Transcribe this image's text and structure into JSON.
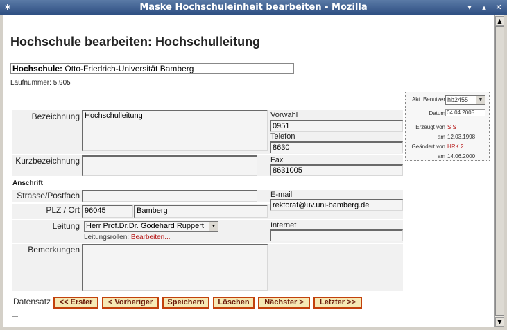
{
  "window": {
    "title": "Maske Hochschuleinheit bearbeiten - Mozilla"
  },
  "page": {
    "heading": "Hochschule bearbeiten: Hochschulleitung",
    "hochschule_label": "Hochschule:",
    "hochschule_value": "Otto-Friedrich-Universität Bamberg",
    "laufnummer": "Laufnummer: 5.905"
  },
  "form": {
    "bezeichnung_label": "Bezeichnung",
    "bezeichnung_value": "Hochschulleitung",
    "kurzbezeichnung_label": "Kurzbezeichnung",
    "kurzbezeichnung_value": "",
    "anschrift_heading": "Anschrift",
    "strasse_label": "Strasse/Postfach",
    "strasse_value": "",
    "plz_ort_label": "PLZ / Ort",
    "plz_value": "96045",
    "ort_value": "Bamberg",
    "leitung_label": "Leitung",
    "leitung_value": "Herr Prof.Dr.Dr. Godehard Ruppert",
    "leitungsrollen_label": "Leitungsrollen:",
    "leitungsrollen_link": "Bearbeiten...",
    "bemerkungen_label": "Bemerkungen",
    "bemerkungen_value": "",
    "vorwahl_label": "Vorwahl",
    "vorwahl_value": "0951",
    "telefon_label": "Telefon",
    "telefon_value": "8630",
    "fax_label": "Fax",
    "fax_value": "8631005",
    "email_label": "E-mail",
    "email_value": "rektorat@uv.uni-bamberg.de",
    "internet_label": "Internet",
    "internet_value": ""
  },
  "info_panel": {
    "akt_benutzer_label": "Akt. Benutzer",
    "akt_benutzer_value": "hb2455",
    "datum_label": "Datum",
    "datum_value": "04.04.2005",
    "erzeugt_von_label": "Erzeugt von",
    "erzeugt_von_value": "SIS",
    "erzeugt_am_label": "am",
    "erzeugt_am_value": "12.03.1998",
    "geaendert_von_label": "Geändert von",
    "geaendert_von_value": "HRK 2",
    "geaendert_am_label": "am",
    "geaendert_am_value": "14.06.2000"
  },
  "navigation": {
    "label": "Datensatz",
    "erster": "<< Erster",
    "vorheriger": "< Vorheriger",
    "speichern": "Speichern",
    "loeschen": "Löschen",
    "naechster": "Nächster >",
    "letzter": "Letzter >>"
  },
  "colors": {
    "button_border": "#c2410c",
    "button_fill": "#f6e9b5",
    "highlight_red": "#b41010"
  }
}
